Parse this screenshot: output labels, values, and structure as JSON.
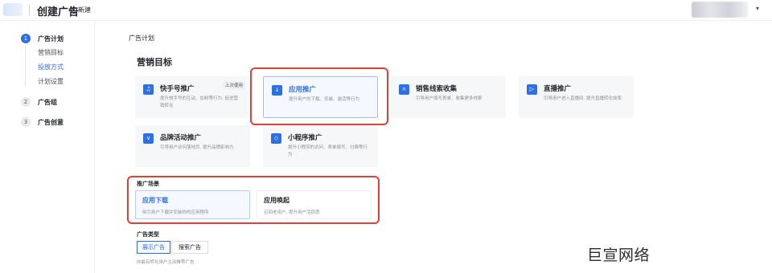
{
  "header": {
    "title": "创建广告",
    "badge": "新建",
    "badge_icon": "circle-c-icon",
    "dropdown_icon": "caret-down-icon"
  },
  "steps": [
    {
      "num": "1",
      "label": "广告计划",
      "sub": [
        "营销目标",
        "投放方式",
        "计划设置"
      ],
      "active_sub": "投放方式"
    },
    {
      "num": "2",
      "label": "广告组"
    },
    {
      "num": "3",
      "label": "广告创意"
    }
  ],
  "main": {
    "section_title": "广告计划",
    "goal_title": "营销目标",
    "goals": [
      {
        "title": "快手号推广",
        "desc": "提升快手号的互动、加粉等行为, 促进营销转化",
        "tag": "上次使用",
        "icon": "kuaishou-icon"
      },
      {
        "title": "应用推广",
        "desc": "提升用户的下载、安装、激活等行为",
        "icon": "download-icon"
      },
      {
        "title": "销售线索收集",
        "desc": "引导用户填写表单、收集更多线索",
        "icon": "form-icon"
      },
      {
        "title": "直播推广",
        "desc": "引导用户进入直播间, 提升直播转化效率",
        "icon": "play-icon"
      },
      {
        "title": "品牌活动推广",
        "desc": "引导用户访问落地页, 提升品牌影响力",
        "icon": "brand-icon"
      },
      {
        "title": "小程序推广",
        "desc": "提升小程序的访问、表单填写、付费等行为",
        "icon": "mini-program-icon"
      }
    ],
    "scene_title": "推广场景",
    "scenes": [
      {
        "title": "应用下载",
        "desc": "吸引用户下载并安装你的应用程序"
      },
      {
        "title": "应用唤起",
        "desc": "召回老用户, 提升用户活跃度"
      }
    ],
    "type_title": "广告类型",
    "types": [
      "展示广告",
      "搜索广告"
    ],
    "type_desc": "向最有转化用户主动推荐广告"
  },
  "watermark": "巨宣网络",
  "colors": {
    "accent": "#2f6fe4",
    "highlight": "#e0403a"
  }
}
